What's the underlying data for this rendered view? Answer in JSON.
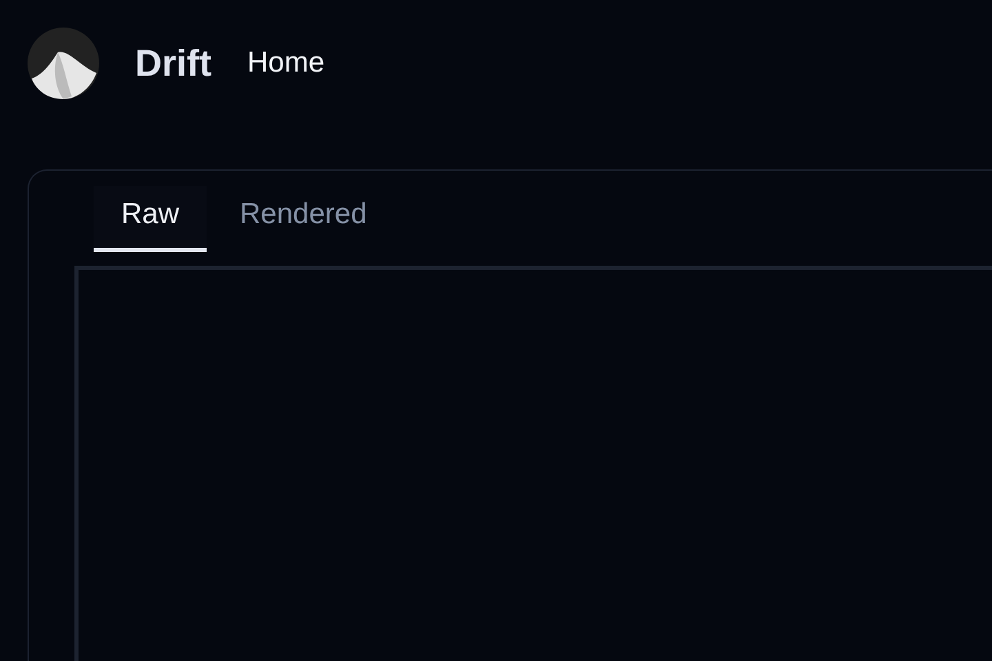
{
  "header": {
    "brand": "Drift",
    "nav": [
      "Home"
    ]
  },
  "tabs": [
    {
      "label": "Raw",
      "selected": true
    },
    {
      "label": "Rendered",
      "selected": false
    }
  ]
}
